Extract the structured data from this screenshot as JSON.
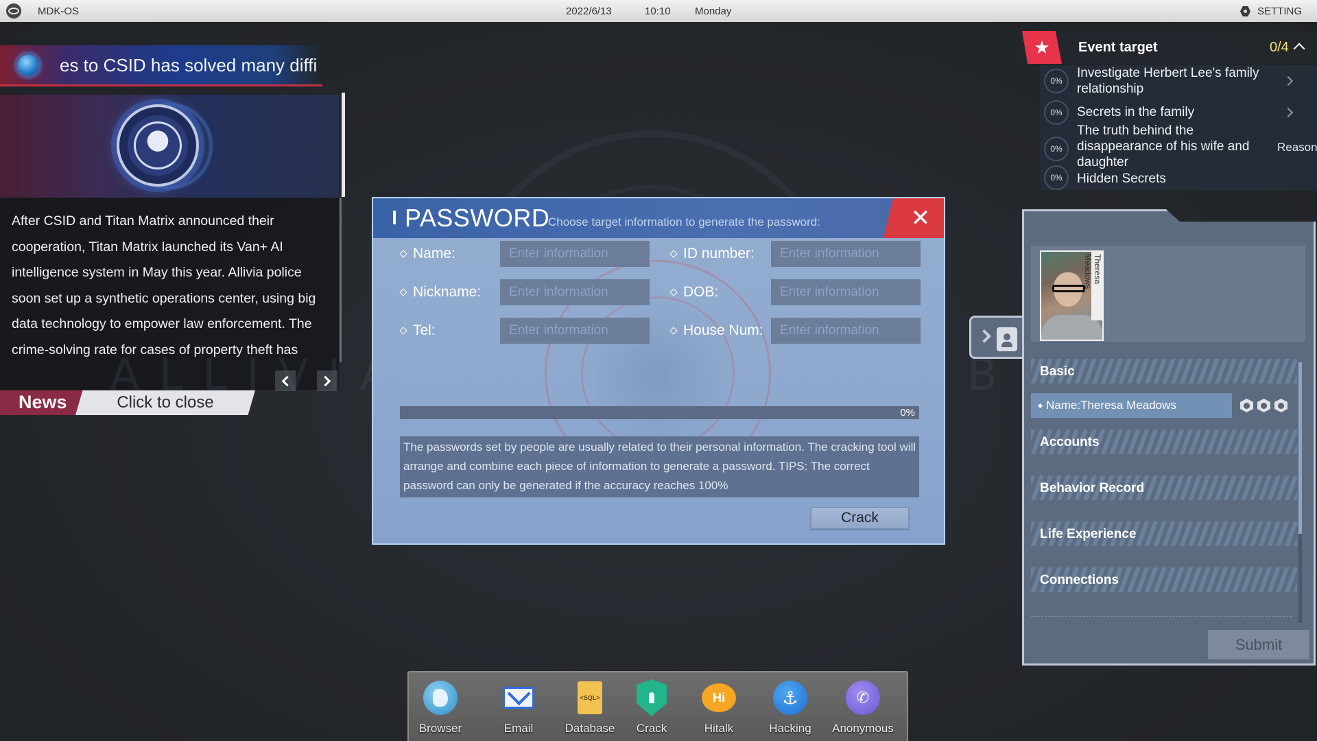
{
  "topbar": {
    "os_name": "MDK-OS",
    "date": "2022/6/13",
    "time": "10:10",
    "day": "Monday",
    "setting_label": "SETTING"
  },
  "news": {
    "ticker": "es to CSID has solved many diffi",
    "article": "After CSID and Titan Matrix announced their cooperation, Titan Matrix launched its Van+ AI intelligence system in May this year. Allivia police soon set up a synthetic operations center, using big data technology to empower law enforcement. The crime-solving rate for cases of property theft has",
    "watermark": "ALLIVIA",
    "tag_label": "News",
    "close_label": "Click to close"
  },
  "dialog": {
    "title": "PASSWORD",
    "subtitle": "Choose target information to generate the password:",
    "close_glyph": "✕",
    "fields": [
      {
        "label": "Name:",
        "value": "",
        "placeholder": "Enter information"
      },
      {
        "label": "ID number:",
        "value": "",
        "placeholder": "Enter information"
      },
      {
        "label": "Nickname:",
        "value": "",
        "placeholder": "Enter information"
      },
      {
        "label": "DOB:",
        "value": "",
        "placeholder": "Enter information"
      },
      {
        "label": "Tel:",
        "value": "",
        "placeholder": "Enter information"
      },
      {
        "label": "House Num:",
        "value": "",
        "placeholder": "Enter information"
      }
    ],
    "progress_percent": 0,
    "progress_label": "0%",
    "tips": "The passwords set by people are usually related to their personal information. The cracking tool will arrange and combine each piece of information to generate a password. TIPS: The correct password can only be generated if the accuracy reaches 100%",
    "crack_label": "Crack"
  },
  "event_target": {
    "title": "Event target",
    "count": "0/4",
    "tasks": [
      {
        "progress": "0%",
        "text": "Investigate Herbert Lee's family relationship",
        "has_arrow": true
      },
      {
        "progress": "0%",
        "text": "Secrets in the family",
        "has_arrow": true
      },
      {
        "progress": "0%",
        "text": "The truth behind the disappearance of his wife and daughter",
        "tag": "Reasoning"
      },
      {
        "progress": "0%",
        "text": "Hidden Secrets"
      }
    ]
  },
  "profile": {
    "photo_name": "Theresa Meadows",
    "sections": [
      "Basic",
      "Accounts",
      "Behavior Record",
      "Life Experience",
      "Connections"
    ],
    "name_row": "Name:Theresa Meadows",
    "row_icons": [
      "hex-globe-icon",
      "hex-shield-icon",
      "hex-id-card-icon"
    ],
    "submit_label": "Submit",
    "bg_watermark": "B"
  },
  "dock": {
    "apps": [
      {
        "label": "Browser",
        "icon": "browser-globe-icon"
      },
      {
        "label": "Email",
        "icon": "email-envelope-icon"
      },
      {
        "label": "Database",
        "icon": "database-sql-icon",
        "glyph": "<SQL>"
      },
      {
        "label": "Crack",
        "icon": "crack-shield-icon"
      },
      {
        "label": "Hitalk",
        "icon": "hitalk-bubble-icon",
        "glyph": "Hi"
      },
      {
        "label": "Hacking",
        "icon": "hacking-hook-icon",
        "glyph": "⚓"
      },
      {
        "label": "Anonymous",
        "icon": "anonymous-phone-icon",
        "glyph": "✆"
      }
    ]
  },
  "colors": {
    "accent_red": "#e8334a",
    "dialog_header": "#3a62a8",
    "event_count": "#f2e466"
  }
}
